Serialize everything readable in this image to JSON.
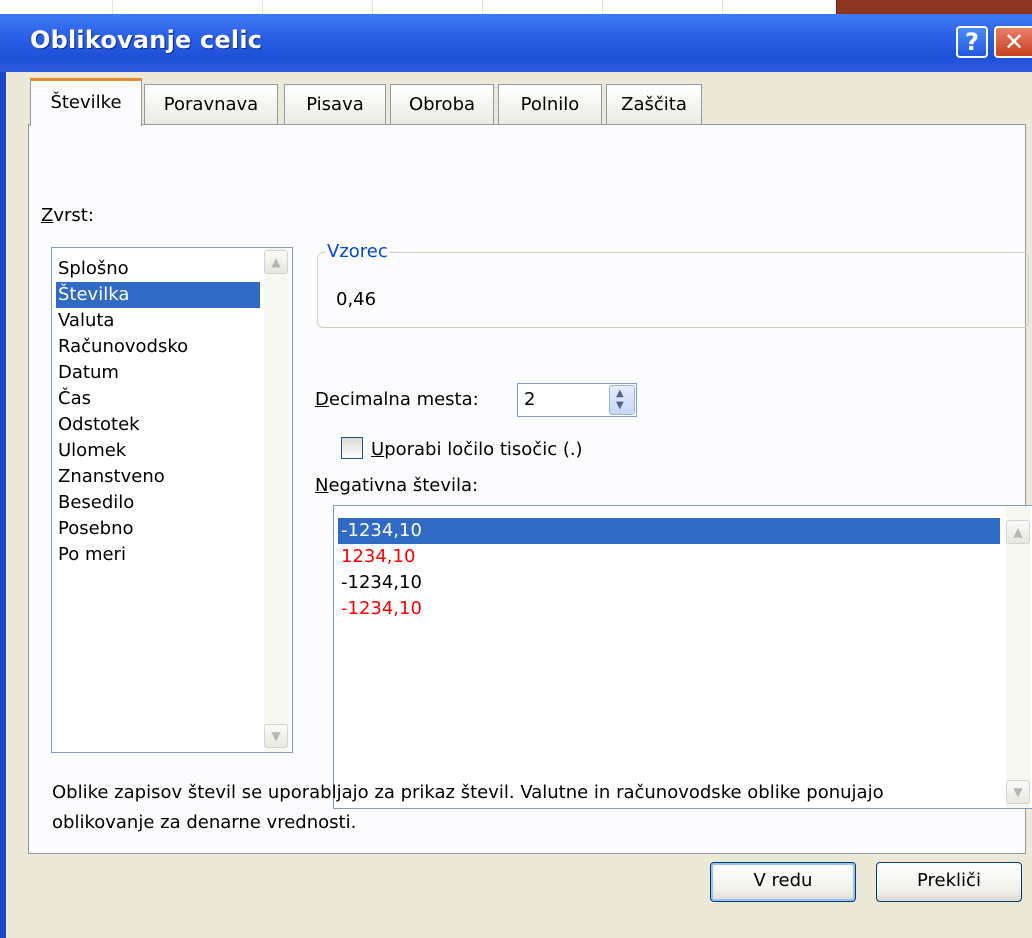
{
  "window": {
    "title": "Oblikovanje celic",
    "help_glyph": "?",
    "close_glyph": "✕"
  },
  "tabs": [
    {
      "label": "Števil",
      "rest": "ke",
      "full": "Številke"
    },
    {
      "full": "Poravnava"
    },
    {
      "full": "Pisava"
    },
    {
      "full": "Obroba"
    },
    {
      "full": "Polnilo"
    },
    {
      "full": "Zaščita"
    }
  ],
  "category": {
    "label": "Zvrst:",
    "label_accel": "Z",
    "label_rest": "vrst:",
    "items": [
      "Splošno",
      "Številka",
      "Valuta",
      "Računovodsko",
      "Datum",
      "Čas",
      "Odstotek",
      "Ulomek",
      "Znanstveno",
      "Besedilo",
      "Posebno",
      "Po meri"
    ],
    "selected": "Številka"
  },
  "sample": {
    "legend": "Vzorec",
    "value": "0,46"
  },
  "decimal": {
    "label_accel": "D",
    "label_rest": "ecimalna mesta:",
    "value": "2"
  },
  "thousands": {
    "label_accel": "U",
    "label_rest": "porabi ločilo tisočic (.)",
    "checked": false
  },
  "negative": {
    "label_accel": "N",
    "label_rest": "egativna števila:",
    "items": [
      {
        "text": "-1234,10",
        "color": "#000000"
      },
      {
        "text": "1234,10",
        "color": "#ff0000"
      },
      {
        "text": "-1234,10",
        "color": "#000000"
      },
      {
        "text": "-1234,10",
        "color": "#ff0000"
      }
    ],
    "selected_index": 0
  },
  "description": "Oblike zapisov števil se uporabljajo za prikaz števil. Valutne in računovodske oblike ponujajo oblikovanje za denarne vrednosti.",
  "buttons": {
    "ok": "V redu",
    "cancel": "Prekliči"
  },
  "colors": {
    "selection": "#316ac5",
    "titlebar": "#2a5fe6",
    "tab_accent": "#e68b2c",
    "legend_text": "#0046d5"
  }
}
